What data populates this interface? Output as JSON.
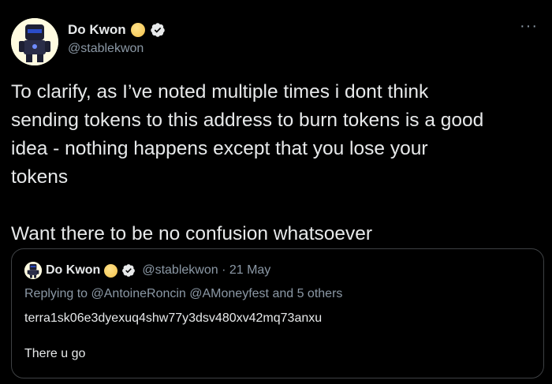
{
  "author": {
    "name": "Do Kwon",
    "handle": "@stablekwon"
  },
  "tweet": {
    "paragraph1": "To clarify, as I’ve noted multiple times i dont think\nsending tokens to this address to burn tokens is a good\nidea - nothing happens except that you lose your\ntokens",
    "paragraph2": "Want there to be no confusion whatsoever"
  },
  "quote": {
    "name": "Do Kwon",
    "handle_date": "@stablekwon · 21 May",
    "replying_prefix": "Replying to",
    "mentions": "@AntoineRoncin @AMoneyfest",
    "others": "and 5 others",
    "address": "terra1sk06e3dyexuq4shw77y3dsv480xv42mq73anxu",
    "text": "There u go"
  },
  "more_label": "···",
  "colors": {
    "background": "#000000",
    "text": "#e7e9ea",
    "secondary": "#8b98a5",
    "border": "#3e4144",
    "coin": "#f3c14b"
  },
  "icons": [
    "avatar-robot",
    "coin-icon",
    "verified-icon",
    "more-icon"
  ]
}
